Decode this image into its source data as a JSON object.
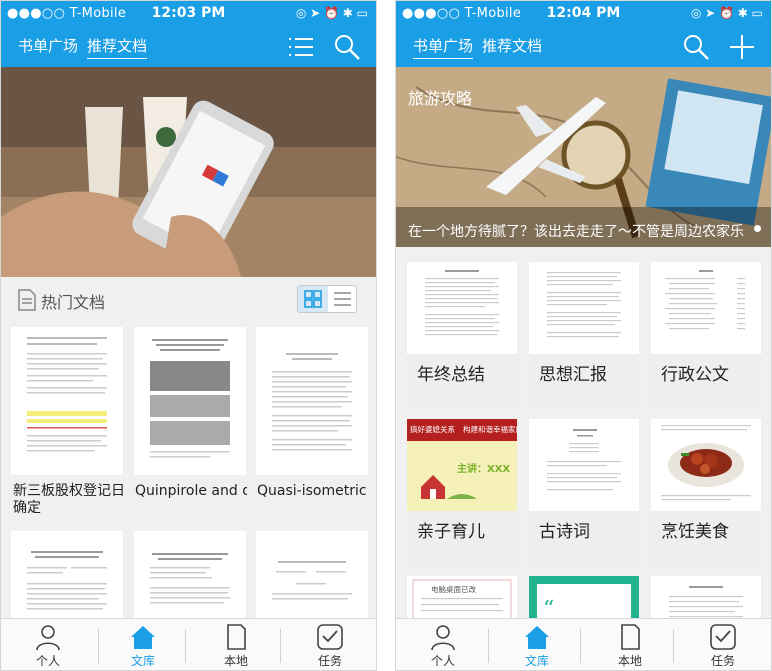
{
  "screens": [
    {
      "status": {
        "carrier": "●●●○○ T-Mobile",
        "time": "12:03 PM"
      },
      "nav": {
        "tabs": [
          "书单广场",
          "推荐文档"
        ],
        "active_tab": 1
      },
      "section": {
        "title": "热门文档"
      },
      "docs": [
        {
          "title": "新三板股权登记日确定"
        },
        {
          "title": "Quinpirole and d-amphetamin..."
        },
        {
          "title": "Quasi-isometric rigidity and dio..."
        }
      ],
      "tabbar": [
        "个人",
        "文库",
        "本地",
        "任务"
      ],
      "active_tabbar": 1
    },
    {
      "status": {
        "carrier": "●●●○○ T-Mobile",
        "time": "12:04 PM"
      },
      "nav": {
        "tabs": [
          "书单广场",
          "推荐文档"
        ],
        "active_tab": 0
      },
      "banner": {
        "title": "旅游攻略",
        "caption": "在一个地方待腻了？该出去走走了～不管是周边农家乐"
      },
      "categories": [
        "年终总结",
        "思想汇报",
        "行政公文",
        "亲子育儿",
        "古诗词",
        "烹饪美食"
      ],
      "tile_texts": {
        "parenting_left": "搞好婆媳关系",
        "parenting_right": "构建和谐幸福家庭",
        "parenting_host": "主讲：XXX",
        "poem_header": "电脑桌面已改"
      },
      "tabbar": [
        "个人",
        "文库",
        "本地",
        "任务"
      ],
      "active_tabbar": 1
    }
  ],
  "colors": {
    "brand": "#1a9ee5"
  }
}
